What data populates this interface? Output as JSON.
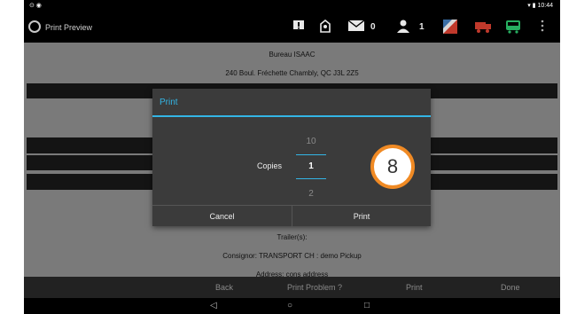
{
  "status_bar": {
    "left_icons": "⊙ ◉",
    "time": "10:44"
  },
  "app_bar": {
    "title": "Print Preview",
    "mail_count": "0",
    "person_count": "1"
  },
  "document": {
    "lines": [
      "Bureau ISAAC",
      "240 Boul. Fréchette Chambly, QC J3L 2Z5",
      "Trailer(s):",
      "Consignor:  TRANSPORT CH : demo Pickup",
      "Address:  cons address"
    ]
  },
  "dialog": {
    "title": "Print",
    "copies_label": "Copies",
    "picker_prev": "10",
    "picker_value": "1",
    "picker_next": "2",
    "cancel_label": "Cancel",
    "print_label": "Print"
  },
  "badge": {
    "number": "8"
  },
  "bottom_nav": {
    "back": "Back",
    "print_problem": "Print Problem ?",
    "print": "Print",
    "done": "Done"
  },
  "system_nav": {
    "back": "◁",
    "home": "○",
    "recents": "□"
  },
  "colors": {
    "accent": "#33b5e5",
    "badge_border": "#f08a24"
  }
}
